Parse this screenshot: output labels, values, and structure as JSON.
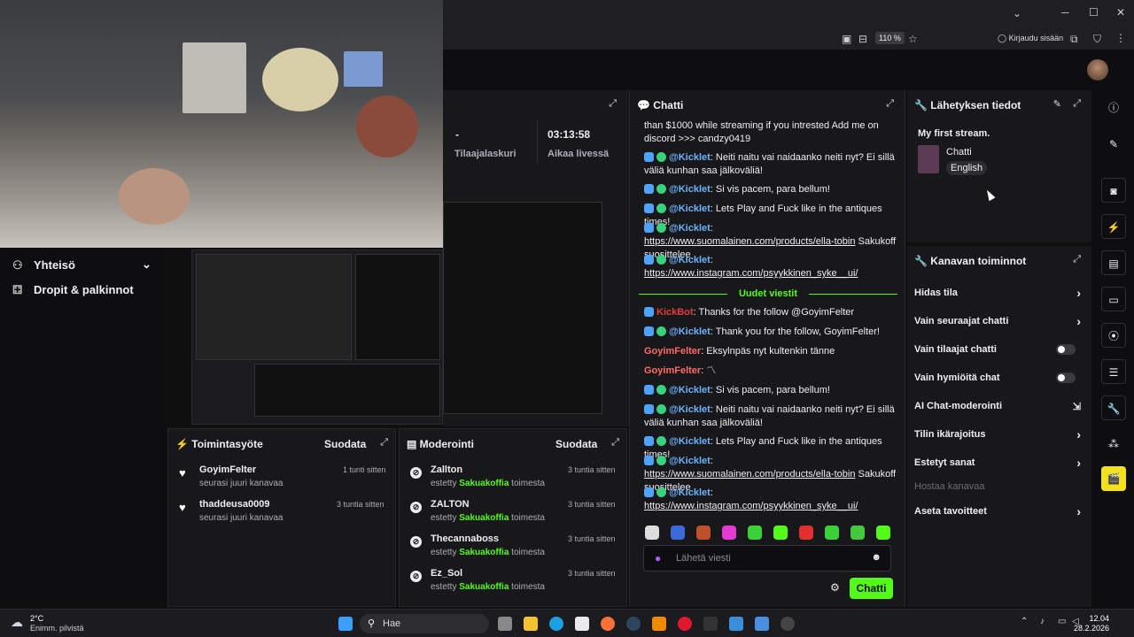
{
  "browser": {
    "zoom": "110 %",
    "login_label": "Kirjaudu sisään",
    "win_min": "─",
    "win_max": "☐",
    "win_close": "✕",
    "tabs_chevron": "⌄"
  },
  "leftnav": {
    "items": [
      {
        "label": "Yhteisö",
        "icon": "community-icon"
      },
      {
        "label": "Dropit & palkinnot",
        "icon": "drops-icon"
      }
    ]
  },
  "stats": {
    "subs_value": "-",
    "subs_label": "Tilaajalaskuri",
    "live_value": "03:13:58",
    "live_label": "Aikaa livessä"
  },
  "chat": {
    "title": "Chatti",
    "new_messages_label": "Uudet viestit",
    "input_placeholder": "Lähetä viesti",
    "send_label": "Chatti",
    "messages": [
      {
        "user": "",
        "text": "than $1000 while streaming if you intrested Add me on discord >>> candzy0419"
      },
      {
        "user": "@Kicklet",
        "text": ": Neiti naitu vai naidaanko neiti nyt? Ei sillä väliä kunhan saa jälkoväliä!"
      },
      {
        "user": "@Kicklet",
        "text": ": Si vis pacem, para bellum!"
      },
      {
        "user": "@Kicklet",
        "text": ": Lets Play and Fuck like in the antiques times!"
      },
      {
        "user": "@Kicklet",
        "link": "https://www.suomalainen.com/products/ella-tobin",
        "text": " Sakukoff suosittelee"
      },
      {
        "user": "@Kicklet",
        "link": "https://www.instagram.com/psyykkinen_syke__ui/",
        "text": ""
      },
      {
        "user": "KickBot",
        "text": ": Thanks for the follow @GoyimFelter"
      },
      {
        "user": "@Kicklet",
        "text": ": Thank you for the follow, GoyimFelter!"
      },
      {
        "user": "GoyimFelter",
        "text": ": Eksylnpäs nyt kultenkin tänne"
      },
      {
        "user": "GoyimFelter",
        "text": ":"
      },
      {
        "user": "@Kicklet",
        "text": ": Si vis pacem, para bellum!"
      },
      {
        "user": "@Kicklet",
        "text": ": Neiti naitu vai naidaanko neiti nyt? Ei sillä väliä kunhan saa jälkoväliä!"
      },
      {
        "user": "@Kicklet",
        "text": ": Lets Play and Fuck like in the antiques times!"
      },
      {
        "user": "@Kicklet",
        "link": "https://www.suomalainen.com/products/ella-tobin",
        "text": " Sakukoff suosittelee"
      },
      {
        "user": "@Kicklet",
        "link": "https://www.instagram.com/psyykkinen_syke__ui/",
        "text": ""
      }
    ]
  },
  "stream_info": {
    "title": "Lähetyksen tiedot",
    "stream_title": "My first stream.",
    "category": "Chatti",
    "language": "English"
  },
  "channel_actions": {
    "title": "Kanavan toiminnot",
    "items": [
      {
        "label": "Hidas tila",
        "control": "chevron"
      },
      {
        "label": "Vain seuraajat chatti",
        "control": "chevron"
      },
      {
        "label": "Vain tilaajat chatti",
        "control": "toggle"
      },
      {
        "label": "Vain hymiöitä chat",
        "control": "toggle"
      },
      {
        "label": "AI Chat-moderointi",
        "control": "external"
      },
      {
        "label": "Tilin ikärajoitus",
        "control": "chevron"
      },
      {
        "label": "Estetyt sanat",
        "control": "chevron"
      },
      {
        "label": "Hostaa kanavaa",
        "control": "disabled"
      },
      {
        "label": "Aseta tavoitteet",
        "control": "chevron"
      }
    ]
  },
  "activity": {
    "title": "Toimintasyöte",
    "filter": "Suodata",
    "rows": [
      {
        "name": "GoyimFelter",
        "sub": "seurasi juuri kanavaa",
        "time": "1 tunti sitten"
      },
      {
        "name": "thaddeusa0009",
        "sub": "seurasi juuri kanavaa",
        "time": "3 tuntia sitten"
      }
    ]
  },
  "moderation": {
    "title": "Moderointi",
    "filter": "Suodata",
    "by_prefix": "estetty",
    "by_user": "Sakuakoffia",
    "by_suffix": "toimesta",
    "rows": [
      {
        "name": "Zallton",
        "time": "3 tuntia sitten"
      },
      {
        "name": "ZALTON",
        "time": "3 tuntia sitten"
      },
      {
        "name": "Thecannaboss",
        "time": "3 tuntia sitten"
      },
      {
        "name": "Ez_Sol",
        "time": "3 tuntia sitten"
      }
    ]
  },
  "taskbar": {
    "weather_temp": "2°C",
    "weather_desc": "Enimm. pilvistä",
    "search_label": "Hae",
    "time": "12.04",
    "date": "28.2.2026"
  },
  "colors": {
    "accent": "#53fc18",
    "bg": "#0e0e10",
    "panel": "#18181b"
  }
}
